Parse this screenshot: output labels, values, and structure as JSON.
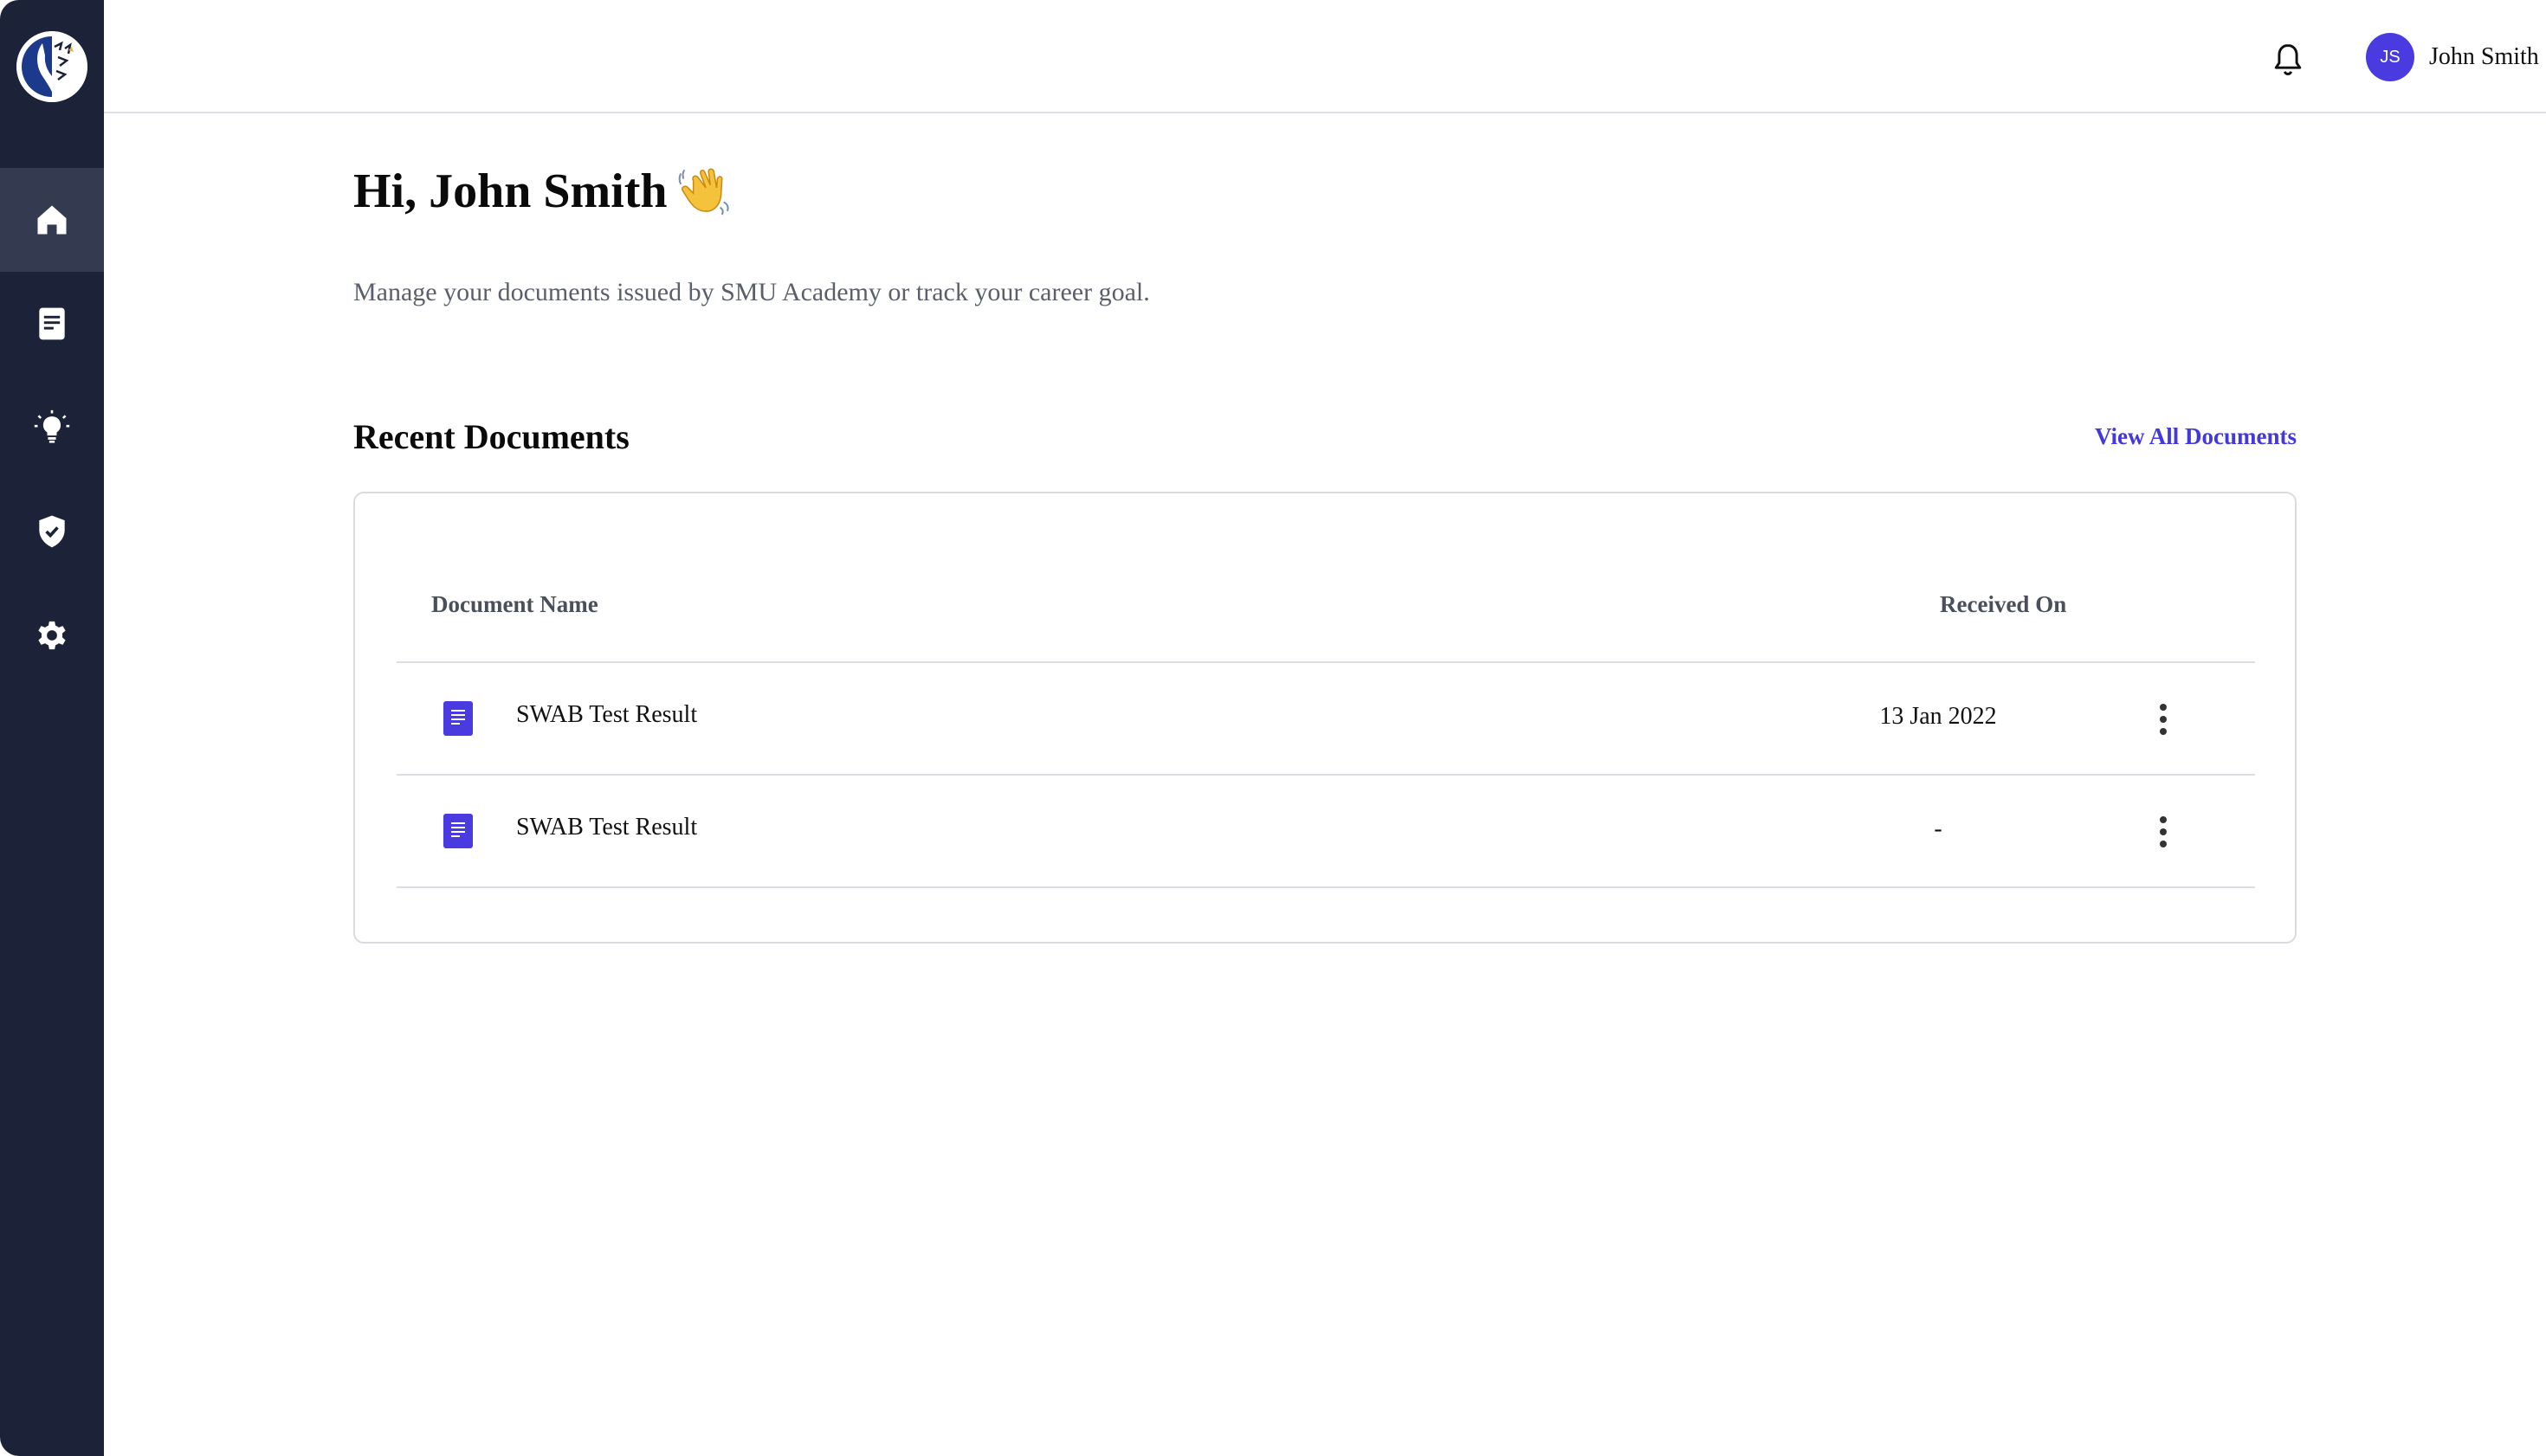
{
  "sidebar": {
    "logo_name": "academy-lion-logo",
    "items": [
      {
        "name": "home",
        "icon": "home-icon",
        "active": true
      },
      {
        "name": "documents",
        "icon": "document-icon",
        "active": false
      },
      {
        "name": "career-goals",
        "icon": "lightbulb-icon",
        "active": false
      },
      {
        "name": "verification",
        "icon": "shield-check-icon",
        "active": false
      },
      {
        "name": "settings",
        "icon": "gear-icon",
        "active": false
      }
    ]
  },
  "header": {
    "notifications_icon": "bell-icon",
    "user": {
      "initials": "JS",
      "name": "John Smith"
    },
    "menu_icon": "chevron-down-icon"
  },
  "main": {
    "greeting": "Hi, John Smith",
    "greeting_emoji": "waving-hand-icon",
    "subtitle": "Manage your documents issued by SMU Academy or track your career goal.",
    "recent_documents": {
      "title": "Recent Documents",
      "view_all_label": "View All Documents",
      "columns": [
        "Document Name",
        "Received On"
      ],
      "rows": [
        {
          "name": "SWAB Test Result",
          "received_on": "13 Jan 2022"
        },
        {
          "name": "SWAB Test Result",
          "received_on": "-"
        }
      ]
    }
  },
  "colors": {
    "sidebar_bg": "#1c2237",
    "sidebar_active": "#343b50",
    "accent": "#4338e0",
    "avatar_bg": "#4a3be0"
  }
}
